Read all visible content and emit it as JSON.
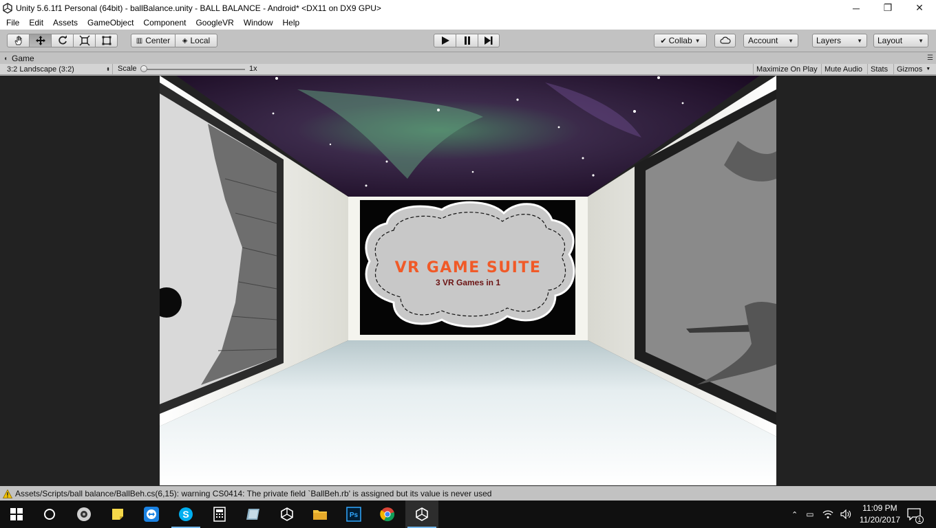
{
  "window": {
    "title": "Unity 5.6.1f1 Personal (64bit) - ballBalance.unity - BALL BALANCE - Android* <DX11 on DX9 GPU>",
    "minimize": "─",
    "maximize": "❐",
    "close": "✕"
  },
  "menu": [
    "File",
    "Edit",
    "Assets",
    "GameObject",
    "Component",
    "GoogleVR",
    "Window",
    "Help"
  ],
  "toolbar": {
    "pivot_label": "Center",
    "space_label": "Local",
    "collab_label": "Collab",
    "account_label": "Account",
    "layers_label": "Layers",
    "layout_label": "Layout"
  },
  "game_tab": {
    "label": "Game"
  },
  "game_bar": {
    "aspect": "3:2 Landscape (3:2)",
    "scale_label": "Scale",
    "scale_value": "1x",
    "maximize_on_play": "Maximize On Play",
    "mute_audio": "Mute Audio",
    "stats": "Stats",
    "gizmos": "Gizmos"
  },
  "scene": {
    "banner_title": "VR GAME SUITE",
    "banner_subtitle": "3 VR Games in 1",
    "title_color": "#f05a28",
    "subtitle_color": "#6b1414"
  },
  "status": {
    "message": "Assets/Scripts/ball balance/BallBeh.cs(6,15): warning CS0414: The private field `BallBeh.rb' is assigned but its value is never used"
  },
  "taskbar": {
    "items": [
      "start",
      "cortana",
      "media-player",
      "sticky-notes",
      "teamviewer",
      "skype",
      "calculator",
      "files",
      "unity",
      "file-explorer",
      "photoshop",
      "chrome",
      "unity-active"
    ],
    "time": "11:09 PM",
    "date": "11/20/2017",
    "notification_count": "1"
  }
}
